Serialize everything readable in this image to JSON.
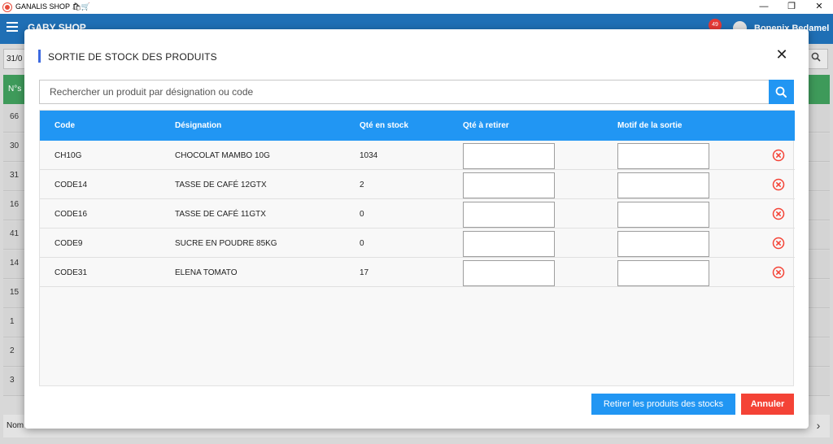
{
  "window": {
    "title": "GANALIS SHOP 🛍🛒",
    "controls": [
      "—",
      "❐",
      "✕"
    ]
  },
  "appbar": {
    "shop_name": "GABY SHOP",
    "notification_count": "49",
    "user_name": "Bonenix Bedamel"
  },
  "background": {
    "date_label": "31/0",
    "header_label": "N°s",
    "row_numbers": [
      "66",
      "30",
      "31",
      "16",
      "41",
      "14",
      "15",
      "1",
      "2",
      "3"
    ],
    "footer_label": "Nom",
    "next_icon": "›"
  },
  "modal": {
    "title": "SORTIE DE STOCK DES PRODUITS",
    "close_icon": "close-icon",
    "search": {
      "placeholder": "Rechercher un produit par désignation ou code"
    },
    "table": {
      "headers": {
        "code": "Code",
        "designation": "Désignation",
        "qte_stock": "Qté en stock",
        "qte_retirer": "Qté à retirer",
        "motif": "Motif de la sortie"
      },
      "rows": [
        {
          "code": "CH10G",
          "designation": "CHOCOLAT MAMBO 10G",
          "qte_stock": "1034",
          "qte_retirer": "",
          "motif": ""
        },
        {
          "code": "CODE14",
          "designation": "TASSE DE CAFÉ 12GTX",
          "qte_stock": "2",
          "qte_retirer": "",
          "motif": ""
        },
        {
          "code": "CODE16",
          "designation": "TASSE DE CAFÉ 11GTX",
          "qte_stock": "0",
          "qte_retirer": "",
          "motif": ""
        },
        {
          "code": "CODE9",
          "designation": "SUCRE EN POUDRE 85KG",
          "qte_stock": "0",
          "qte_retirer": "",
          "motif": ""
        },
        {
          "code": "CODE31",
          "designation": "ELENA TOMATO",
          "qte_stock": "17",
          "qte_retirer": "",
          "motif": ""
        }
      ]
    },
    "buttons": {
      "retirer": "Retirer les produits des stocks",
      "annuler": "Annuler"
    }
  },
  "colors": {
    "primary": "#2196f3",
    "danger": "#f44336",
    "appbar": "#1f6fb5",
    "accent": "#3d6ae0"
  }
}
